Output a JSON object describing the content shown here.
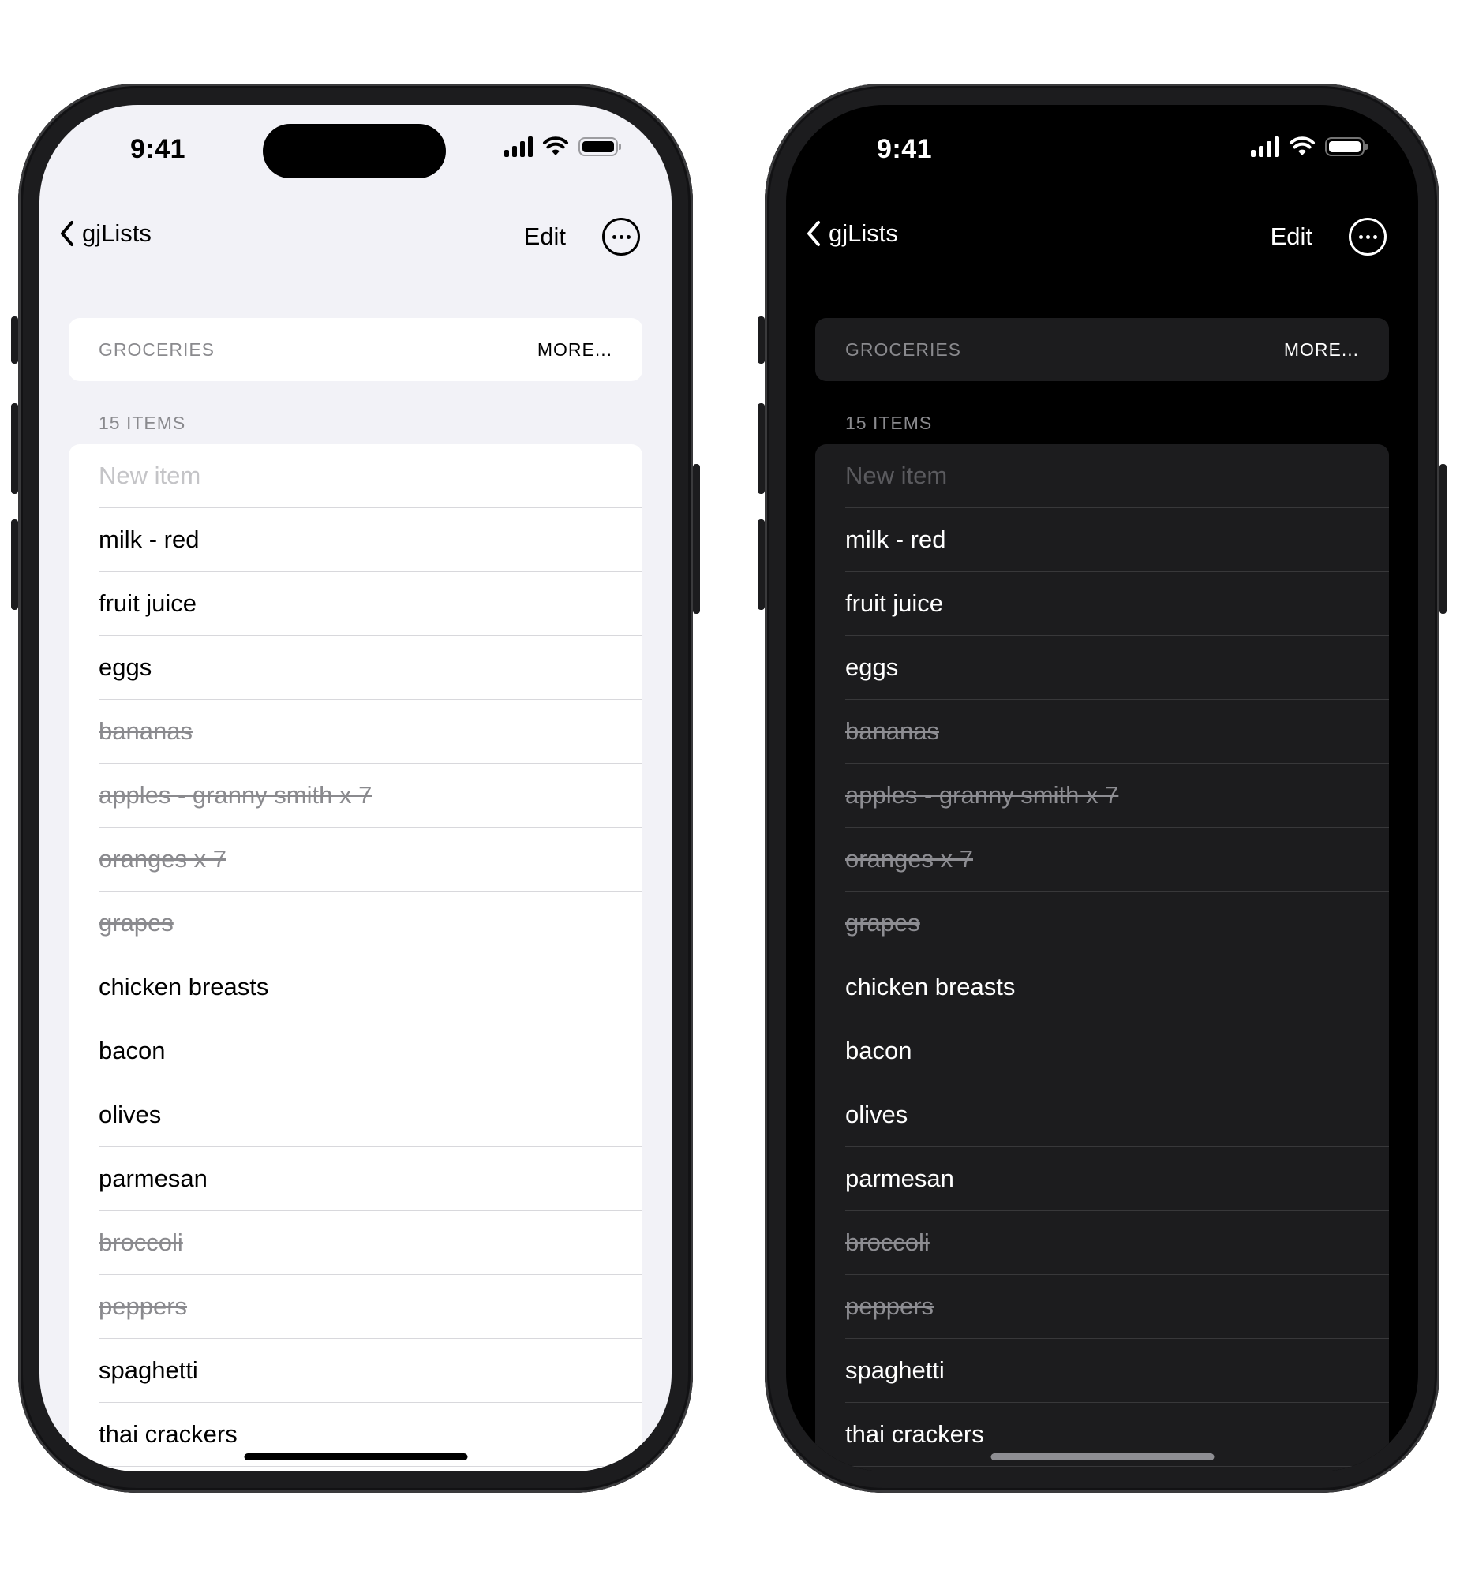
{
  "status": {
    "time": "9:41"
  },
  "nav": {
    "back_label": "gjLists",
    "edit_label": "Edit"
  },
  "header": {
    "title": "GROCERIES",
    "more_label": "MORE..."
  },
  "list": {
    "count_label": "15 ITEMS",
    "placeholder": "New item",
    "items": [
      {
        "label": "milk - red",
        "done": false
      },
      {
        "label": "fruit juice",
        "done": false
      },
      {
        "label": "eggs",
        "done": false
      },
      {
        "label": "bananas",
        "done": true
      },
      {
        "label": "apples - granny smith x 7",
        "done": true
      },
      {
        "label": "oranges x 7",
        "done": true
      },
      {
        "label": "grapes",
        "done": true
      },
      {
        "label": "chicken breasts",
        "done": false
      },
      {
        "label": "bacon",
        "done": false
      },
      {
        "label": "olives",
        "done": false
      },
      {
        "label": "parmesan",
        "done": false
      },
      {
        "label": "broccoli",
        "done": true
      },
      {
        "label": "peppers",
        "done": true
      },
      {
        "label": "spaghetti",
        "done": false
      },
      {
        "label": "thai crackers",
        "done": false
      }
    ]
  },
  "themes": [
    {
      "name": "light",
      "accent": "#000000",
      "background": "#f2f2f7"
    },
    {
      "name": "dark",
      "accent": "#ffffff",
      "background": "#000000"
    }
  ],
  "icons": [
    "chevron-left-icon",
    "cellular-signal-icon",
    "wifi-icon",
    "battery-icon",
    "ellipsis-circle-icon"
  ]
}
